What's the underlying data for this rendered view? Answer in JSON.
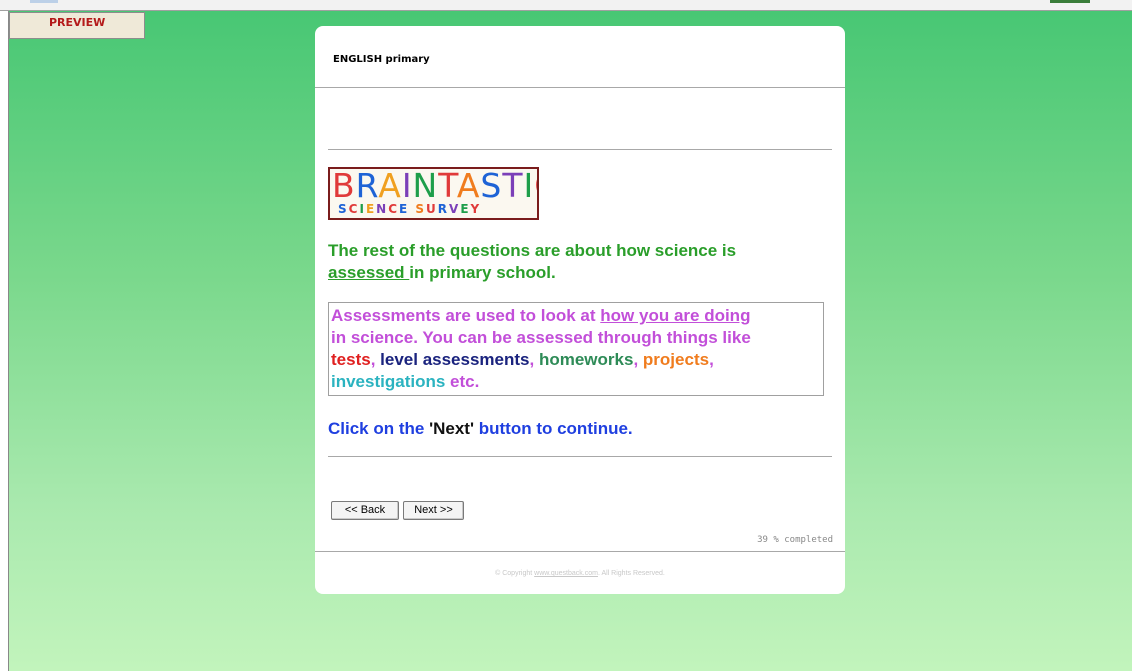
{
  "preview_label": "PREVIEW",
  "survey_title": "ENGLISH primary",
  "logo": {
    "line1": "BRAINTASTIC",
    "line2": "SCIENCE SURVEY"
  },
  "intro": {
    "part1": "The rest of the questions are about how science is",
    "link": "assessed ",
    "part2": "in primary school."
  },
  "assessment": {
    "line1_pre": "Assessments are used to look at ",
    "line1_link": "how you are doing",
    "line2": "in science. You can be assessed through things like",
    "tests": "tests",
    "level": "level assessments",
    "homeworks": "homeworks",
    "projects": "projects",
    "investigations": "investigations",
    "etc": "etc.",
    "comma": ","
  },
  "instruction": {
    "pre": "Click on the ",
    "keyword": "'Next'",
    "post": " button to continue."
  },
  "nav": {
    "back": "<< Back",
    "next": "Next >>"
  },
  "progress_text": "39 % completed",
  "progress_percent": 39,
  "footer": {
    "pre": "© Copyright ",
    "link": "www.questback.com",
    "post": ". All Rights Reserved."
  },
  "colors": {
    "intro": "#2a9e2a",
    "assessment": "#c24fd9",
    "tests": "#e02020",
    "level": "#1a237e",
    "homeworks": "#2e8b57",
    "projects": "#f07c1e",
    "investigations": "#2bb3c0",
    "instruction": "#1f3fe0"
  }
}
